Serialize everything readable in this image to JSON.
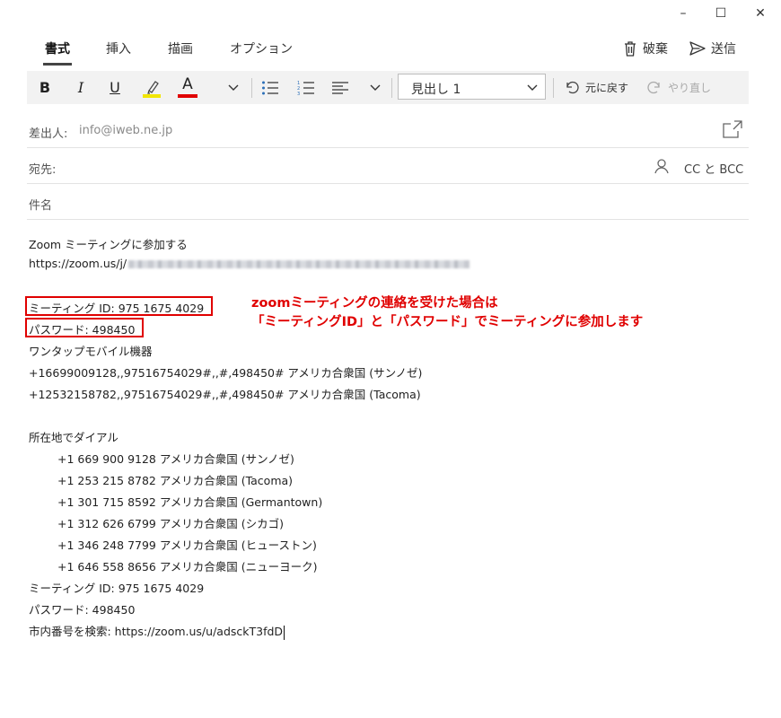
{
  "window_controls": {
    "minimize": "–",
    "maximize": "☐",
    "close": "✕"
  },
  "tabs": [
    {
      "label": "書式",
      "active": true
    },
    {
      "label": "挿入",
      "active": false
    },
    {
      "label": "描画",
      "active": false
    },
    {
      "label": "オプション",
      "active": false
    }
  ],
  "header_actions": {
    "discard": "破棄",
    "send": "送信"
  },
  "toolbar": {
    "bold": "B",
    "italic": "I",
    "underline": "U",
    "font_color": "A",
    "style_value": "見出し 1",
    "undo": "元に戻す",
    "redo": "やり直し",
    "highlight_color": "#f2e600",
    "font_color_bar": "#e00000"
  },
  "fields": {
    "from_label": "差出人:",
    "from_value": "info@iweb.ne.jp",
    "to_label": "宛先:",
    "cc_bcc": "CC と BCC",
    "subject_placeholder": "件名"
  },
  "body": {
    "l1": "Zoom ミーティングに参加する",
    "l2": "https://zoom.us/j/",
    "l3": "ミーティング ID: 975 1675 4029",
    "l4": "パスワード: 498450",
    "l5": "ワンタップモバイル機器",
    "l6": "+16699009128,,97516754029#,,#,498450# アメリカ合衆国 (サンノゼ)",
    "l7": "+12532158782,,97516754029#,,#,498450# アメリカ合衆国 (Tacoma)",
    "l8": "所在地でダイアル",
    "d1": "+1 669 900 9128 アメリカ合衆国 (サンノゼ)",
    "d2": "+1 253 215 8782 アメリカ合衆国 (Tacoma)",
    "d3": "+1 301 715 8592 アメリカ合衆国 (Germantown)",
    "d4": "+1 312 626 6799 アメリカ合衆国 (シカゴ)",
    "d5": "+1 346 248 7799 アメリカ合衆国 (ヒューストン)",
    "d6": "+1 646 558 8656 アメリカ合衆国 (ニューヨーク)",
    "l9": "ミーティング ID: 975 1675 4029",
    "l10": "パスワード: 498450",
    "l11": "市内番号を検索: https://zoom.us/u/adsckT3fdD"
  },
  "annotation": {
    "line1": "zoomミーティングの連絡を受けた場合は",
    "line2": "「ミーティングID」と「パスワード」でミーティングに参加します",
    "color": "#e00000"
  }
}
